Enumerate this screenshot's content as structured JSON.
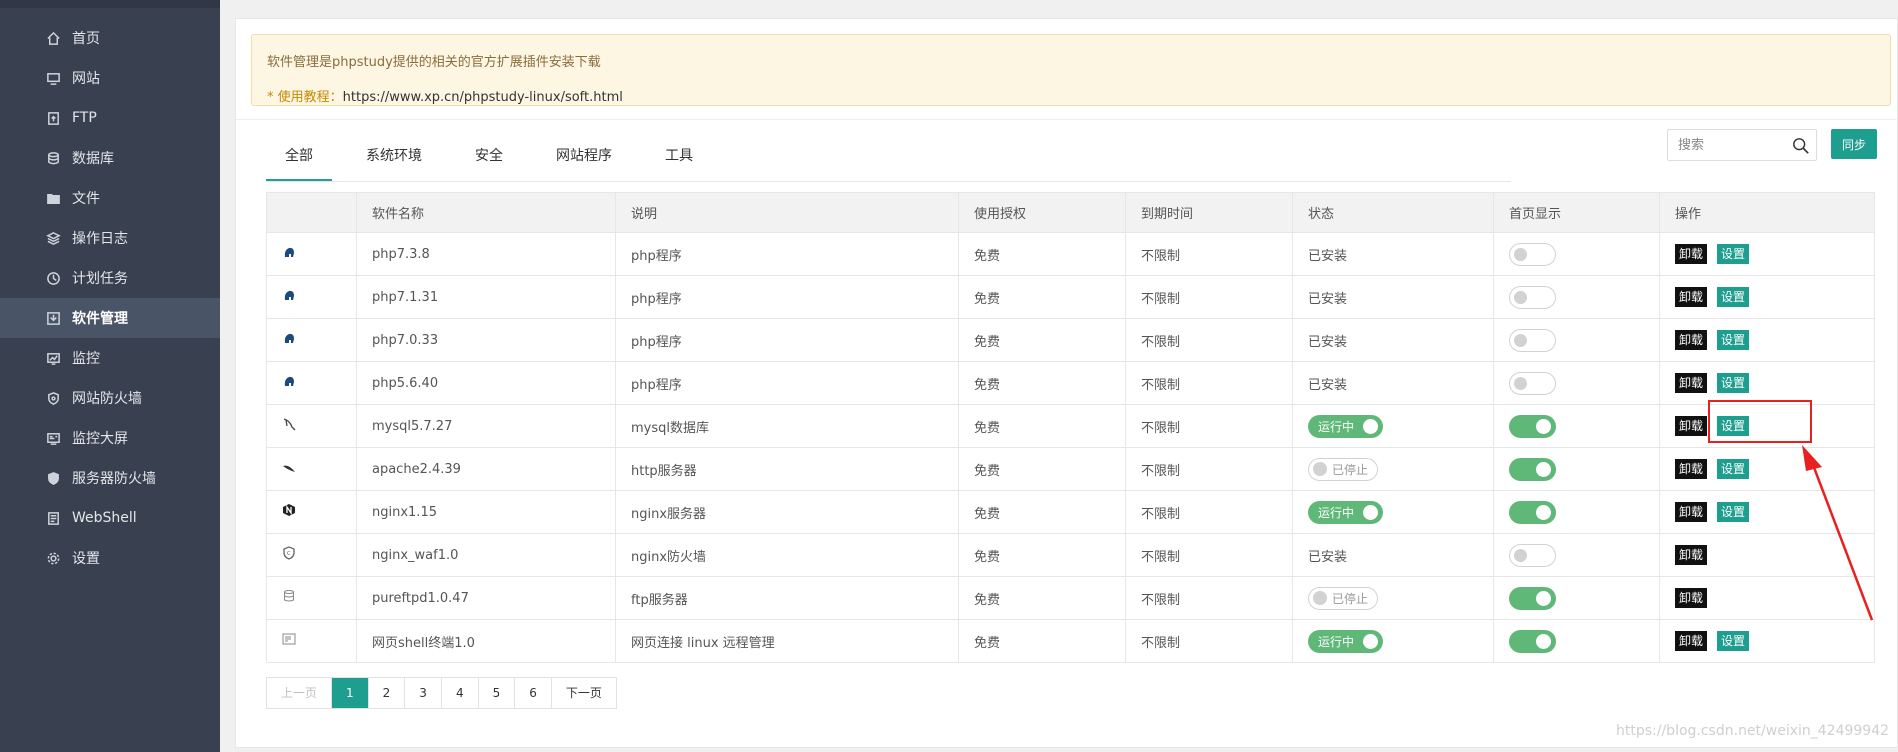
{
  "sidebar": {
    "items": [
      {
        "label": "首页",
        "icon": "home-icon",
        "active": false
      },
      {
        "label": "网站",
        "icon": "monitor-icon",
        "active": false
      },
      {
        "label": "FTP",
        "icon": "ftp-icon",
        "active": false
      },
      {
        "label": "数据库",
        "icon": "database-icon",
        "active": false
      },
      {
        "label": "文件",
        "icon": "folder-icon",
        "active": false
      },
      {
        "label": "操作日志",
        "icon": "layers-icon",
        "active": false
      },
      {
        "label": "计划任务",
        "icon": "clock-icon",
        "active": false
      },
      {
        "label": "软件管理",
        "icon": "download-icon",
        "active": true
      },
      {
        "label": "监控",
        "icon": "chart-monitor-icon",
        "active": false
      },
      {
        "label": "网站防火墙",
        "icon": "shield-icon",
        "active": false
      },
      {
        "label": "监控大屏",
        "icon": "screen-icon",
        "active": false
      },
      {
        "label": "服务器防火墙",
        "icon": "shield-filled-icon",
        "active": false
      },
      {
        "label": "WebShell",
        "icon": "terminal-icon",
        "active": false
      },
      {
        "label": "设置",
        "icon": "gear-icon",
        "active": false
      }
    ]
  },
  "notice": {
    "line1": "软件管理是phpstudy提供的相关的官方扩展插件安装下载",
    "line2_prefix": "* 使用教程：",
    "line2_url": "https://www.xp.cn/phpstudy-linux/soft.html"
  },
  "tabs": [
    "全部",
    "系统环境",
    "安全",
    "网站程序",
    "工具"
  ],
  "search": {
    "placeholder": "搜索"
  },
  "sync_label": "同步",
  "table": {
    "headers": [
      "",
      "软件名称",
      "说明",
      "使用授权",
      "到期时间",
      "状态",
      "首页显示",
      "操作"
    ],
    "rows": [
      {
        "icon": "php-icon",
        "name": "php7.3.8",
        "desc": "php程序",
        "license": "免费",
        "expire": "不限制",
        "status_type": "text",
        "status": "已安装",
        "homepage": false,
        "actions": [
          "卸载",
          "设置"
        ]
      },
      {
        "icon": "php-icon",
        "name": "php7.1.31",
        "desc": "php程序",
        "license": "免费",
        "expire": "不限制",
        "status_type": "text",
        "status": "已安装",
        "homepage": false,
        "actions": [
          "卸载",
          "设置"
        ]
      },
      {
        "icon": "php-icon",
        "name": "php7.0.33",
        "desc": "php程序",
        "license": "免费",
        "expire": "不限制",
        "status_type": "text",
        "status": "已安装",
        "homepage": false,
        "actions": [
          "卸载",
          "设置"
        ]
      },
      {
        "icon": "php-icon",
        "name": "php5.6.40",
        "desc": "php程序",
        "license": "免费",
        "expire": "不限制",
        "status_type": "text",
        "status": "已安装",
        "homepage": false,
        "actions": [
          "卸载",
          "设置"
        ]
      },
      {
        "icon": "mysql-icon",
        "name": "mysql5.7.27",
        "desc": "mysql数据库",
        "license": "免费",
        "expire": "不限制",
        "status_type": "running",
        "status": "运行中",
        "homepage": true,
        "actions": [
          "卸载",
          "设置"
        ]
      },
      {
        "icon": "apache-icon",
        "name": "apache2.4.39",
        "desc": "http服务器",
        "license": "免费",
        "expire": "不限制",
        "status_type": "stopped",
        "status": "已停止",
        "homepage": true,
        "actions": [
          "卸载",
          "设置"
        ]
      },
      {
        "icon": "nginx-icon",
        "name": "nginx1.15",
        "desc": "nginx服务器",
        "license": "免费",
        "expire": "不限制",
        "status_type": "running",
        "status": "运行中",
        "homepage": true,
        "actions": [
          "卸载",
          "设置"
        ]
      },
      {
        "icon": "waf-icon",
        "name": "nginx_waf1.0",
        "desc": "nginx防火墙",
        "license": "免费",
        "expire": "不限制",
        "status_type": "text",
        "status": "已安装",
        "homepage": false,
        "actions": [
          "卸载"
        ]
      },
      {
        "icon": "ftp-server-icon",
        "name": "pureftpd1.0.47",
        "desc": "ftp服务器",
        "license": "免费",
        "expire": "不限制",
        "status_type": "stopped",
        "status": "已停止",
        "homepage": true,
        "actions": [
          "卸载"
        ]
      },
      {
        "icon": "shell-icon",
        "name": "网页shell终端1.0",
        "desc": "网页连接 linux 远程管理",
        "license": "免费",
        "expire": "不限制",
        "status_type": "running",
        "status": "运行中",
        "homepage": true,
        "actions": [
          "卸载",
          "设置"
        ]
      }
    ]
  },
  "pagination": {
    "prev": "上一页",
    "pages": [
      "1",
      "2",
      "3",
      "4",
      "5",
      "6"
    ],
    "current": "1",
    "next": "下一页"
  },
  "watermark": "https://blog.csdn.net/weixin_42499942",
  "colors": {
    "accent": "#1e9e8f",
    "toggle_on": "#5fb878",
    "sidebar_bg": "#39404f",
    "annotation": "#e8201f"
  }
}
